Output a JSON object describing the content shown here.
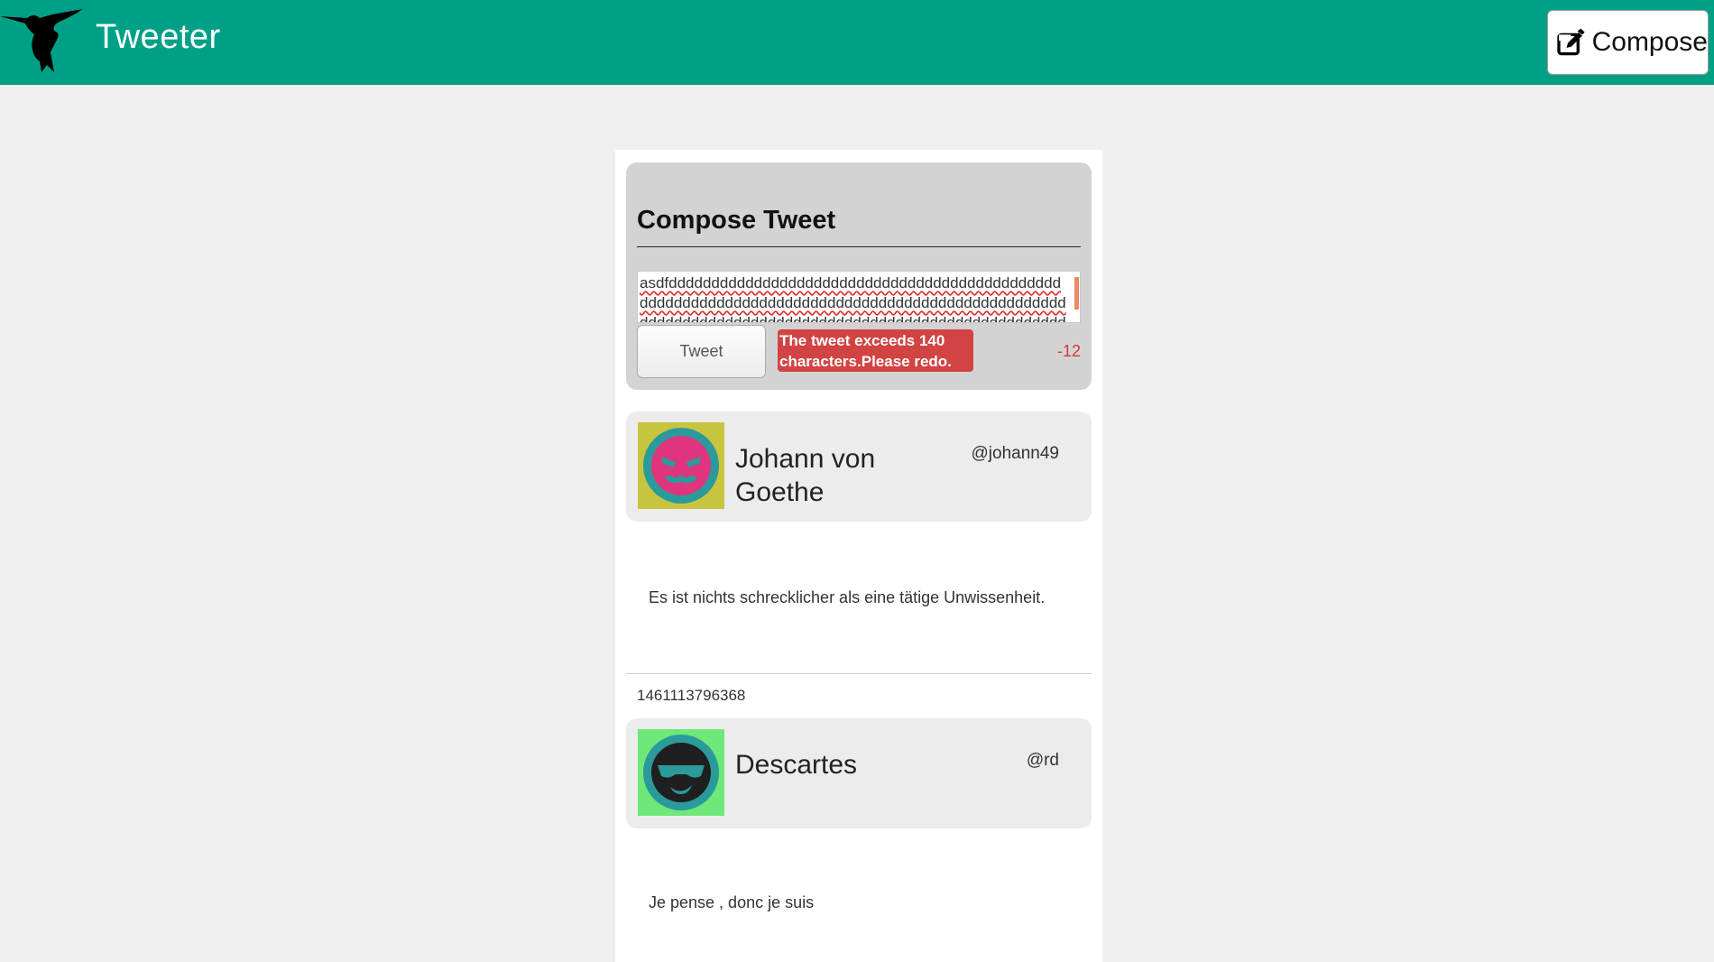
{
  "header": {
    "brand": "Tweeter",
    "compose_label": "Compose",
    "bg_color": "#00a087"
  },
  "compose": {
    "title": "Compose Tweet",
    "text": "asdfddddddddddddddddddddddddddddddddddddddddddddddddddddddddddddddddddddddddddddddddddddddddddddddddddddddddddddddddddddddddddddddddddddddddddddddddddd",
    "tweet_button": "Tweet",
    "error": "The tweet exceeds 140 characters.Please redo.",
    "counter": "-12",
    "error_color": "#d24343"
  },
  "tweets": [
    {
      "name": "Johann von Goethe",
      "handle": "@johann49",
      "text": "Es ist nichts schrecklicher als eine tätige Unwissenheit.",
      "timestamp": "1461113796368",
      "avatar": "pink-devil-face-icon"
    },
    {
      "name": "Descartes",
      "handle": "@rd",
      "text": "Je pense , donc je suis",
      "avatar": "sunglasses-face-icon"
    }
  ]
}
